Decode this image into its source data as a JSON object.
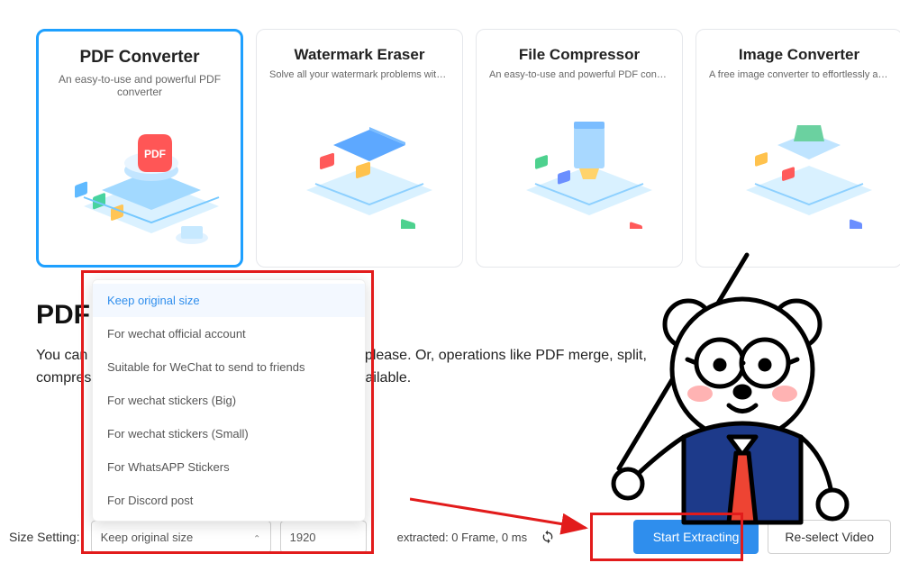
{
  "cards": [
    {
      "title": "PDF Converter",
      "sub": "An easy-to-use and powerful PDF converter",
      "selected": true
    },
    {
      "title": "Watermark Eraser",
      "sub": "Solve all your watermark problems witho...",
      "selected": false
    },
    {
      "title": "File Compressor",
      "sub": "An easy-to-use and powerful PDF converter",
      "selected": false
    },
    {
      "title": "Image Converter",
      "sub": "A free image converter to effortlessly an...",
      "selected": false
    }
  ],
  "section": {
    "title": "PDF",
    "desc": "You can convert your PDF file to any format as you please. Or, operations like PDF merge, split, compression, decryption and encryption are also available."
  },
  "dropdown": {
    "items": [
      "Keep original size",
      "For wechat official account",
      "Suitable for WeChat to send to friends",
      "For wechat stickers (Big)",
      "For wechat stickers (Small)",
      "For WhatsAPP Stickers",
      "For Discord post"
    ],
    "active": 0
  },
  "bottom": {
    "size_label": "Size Setting:",
    "selected_label": "Keep original size",
    "width_value": "1920",
    "status": "extracted: 0 Frame, 0 ms",
    "start_label": "Start Extracting",
    "reselect_label": "Re-select Video"
  }
}
